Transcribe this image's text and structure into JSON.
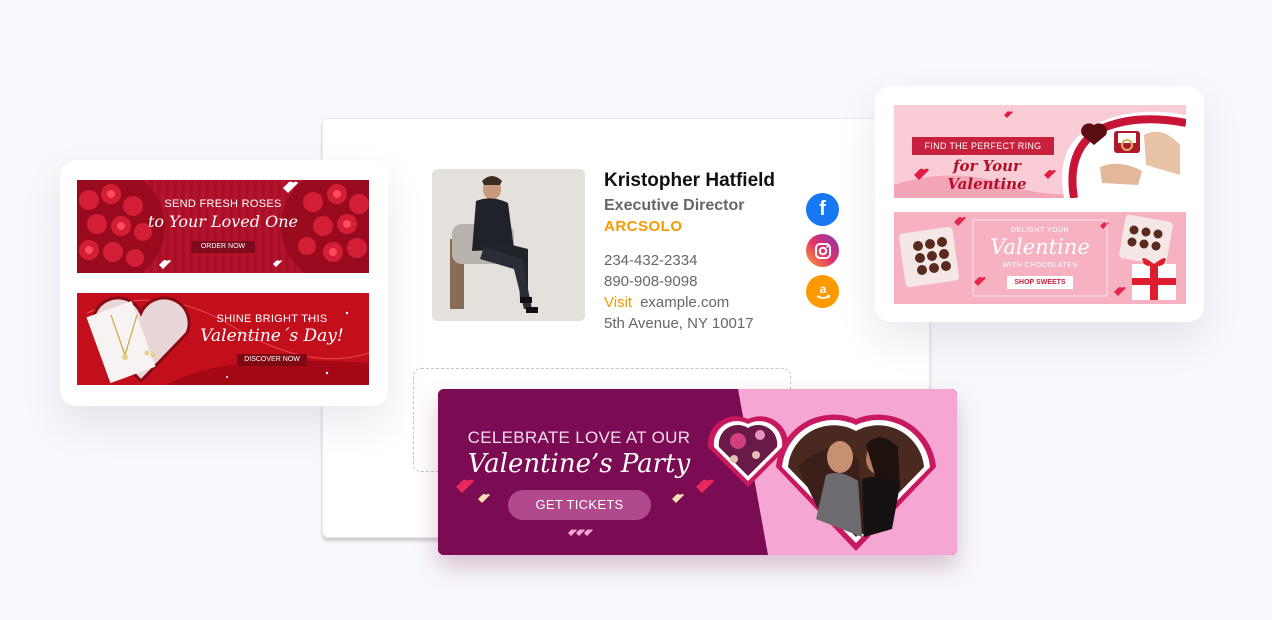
{
  "signature": {
    "name": "Kristopher Hatfield",
    "title": "Executive Director",
    "company": "ARCSOLO",
    "phone1": "234-432-2334",
    "phone2": "890-908-9098",
    "visit_label": "Visit",
    "website": "example.com",
    "address": "5th Avenue, NY 10017",
    "social": [
      {
        "icon": "facebook-icon",
        "glyph": "f",
        "color": "#1877f2"
      },
      {
        "icon": "instagram-icon",
        "glyph": "◎",
        "color": "#d6249f"
      },
      {
        "icon": "amazon-icon",
        "glyph": "a",
        "color": "#ff9900"
      }
    ]
  },
  "banners": {
    "roses": {
      "line1": "SEND FRESH ROSES",
      "line2": "to Your Loved One",
      "cta": "ORDER NOW"
    },
    "shine": {
      "line1": "SHINE BRIGHT THIS",
      "line2": "Valentine´s Day!",
      "cta": "DISCOVER NOW"
    },
    "ring": {
      "line1": "FIND THE PERFECT RING",
      "line2": "for Your Valentine"
    },
    "chocolates": {
      "line1": "DELIGHT YOUR",
      "line2": "Valentine",
      "line3": "WITH CHOCOLATES",
      "cta": "SHOP SWEETS"
    },
    "party": {
      "line1": "CELEBRATE LOVE AT OUR",
      "line2": "Valentine’s Party",
      "cta": "GET TICKETS"
    }
  },
  "colors": {
    "accent": "#f59b00",
    "party_bg": "#7b0b52",
    "party_pink": "#f6a6d3",
    "rose_red": "#b5122b"
  }
}
